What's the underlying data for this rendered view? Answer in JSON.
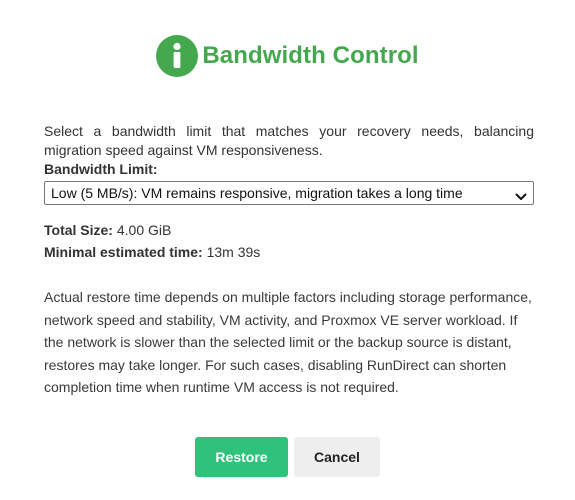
{
  "dialog": {
    "title": "Bandwidth Control",
    "icon": "info-circle-icon",
    "accent_color": "#45a84e",
    "intro": "Select a bandwidth limit that matches your recovery needs, balancing migration speed against VM responsiveness.",
    "bandwidth": {
      "label": "Bandwidth Limit:",
      "selected": "Low (5 MB/s): VM remains responsive, migration takes a long time"
    },
    "stats": {
      "total_size_label": "Total Size:",
      "total_size_value": "4.00 GiB",
      "estimated_time_label": "Minimal estimated time:",
      "estimated_time_value": "13m 39s"
    },
    "note": "Actual restore time depends on multiple factors including storage performance, network speed and stability, VM activity, and Proxmox VE server workload. If the network is slower than the selected limit or the backup source is distant, restores may take longer. For such cases, disabling RunDirect can shorten completion time when runtime VM access is not required.",
    "buttons": {
      "restore": "Restore",
      "cancel": "Cancel",
      "restore_color": "#2ec27a",
      "cancel_color": "#eeeeee"
    }
  }
}
